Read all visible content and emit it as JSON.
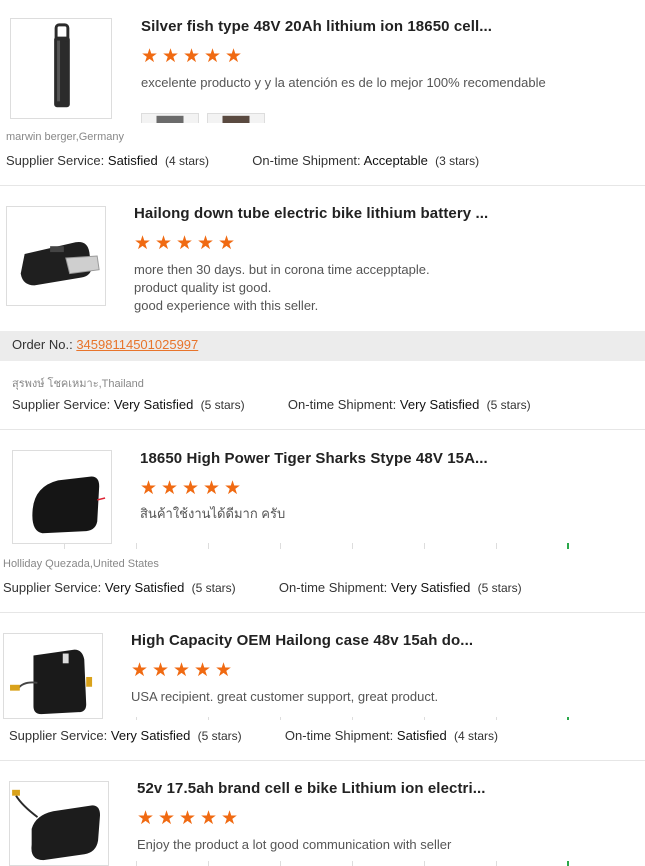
{
  "colors": {
    "star": "#f06a12",
    "order_link": "#e8742b",
    "order_bar": "#ececec"
  },
  "star_glyph": "★",
  "reviews": [
    {
      "product_title": "Silver fish type 48V 20Ah lithium ion 18650 cell...",
      "rating": 5,
      "comment": "excelente producto y y la atención es de lo mejor 100% recomendable",
      "reviewer": "marwin berger,Germany",
      "supplier_label": "Supplier Service:",
      "supplier_value": "Satisfied",
      "supplier_stars": "(4 stars)",
      "shipment_label": "On-time Shipment:",
      "shipment_value": "Acceptable",
      "shipment_stars": "(3 stars)"
    },
    {
      "product_title": "Hailong down tube electric bike lithium battery ...",
      "rating": 5,
      "comment_lines": [
        "more then 30 days. but in corona time accepptaple.",
        "product quality ist good.",
        "good experience with this seller."
      ],
      "order_label": "Order No.:",
      "order_no": "34598114501025997",
      "reviewer": "สุรพงษ์ โชคเหมาะ,Thailand",
      "supplier_label": "Supplier Service:",
      "supplier_value": "Very Satisfied",
      "supplier_stars": "(5 stars)",
      "shipment_label": "On-time Shipment:",
      "shipment_value": "Very Satisfied",
      "shipment_stars": "(5 stars)"
    },
    {
      "product_title": "18650 High Power Tiger Sharks Stype 48V 15A...",
      "rating": 5,
      "comment": "สินค้าใช้งานได้ดีมาก ครับ",
      "reviewer": "Holliday Quezada,United States",
      "supplier_label": "Supplier Service:",
      "supplier_value": "Very Satisfied",
      "supplier_stars": "(5 stars)",
      "shipment_label": "On-time Shipment:",
      "shipment_value": "Very Satisfied",
      "shipment_stars": "(5 stars)"
    },
    {
      "product_title": "High Capacity OEM Hailong case 48v 15ah do...",
      "rating": 5,
      "comment": "USA recipient. great customer support, great product.",
      "supplier_label": "Supplier Service:",
      "supplier_value": "Very Satisfied",
      "supplier_stars": "(5 stars)",
      "shipment_label": "On-time Shipment:",
      "shipment_value": "Satisfied",
      "shipment_stars": "(4 stars)"
    },
    {
      "product_title": "52v 17.5ah brand cell e bike Lithium ion electri...",
      "rating": 5,
      "comment": "Enjoy the product a lot good communication with seller"
    }
  ]
}
